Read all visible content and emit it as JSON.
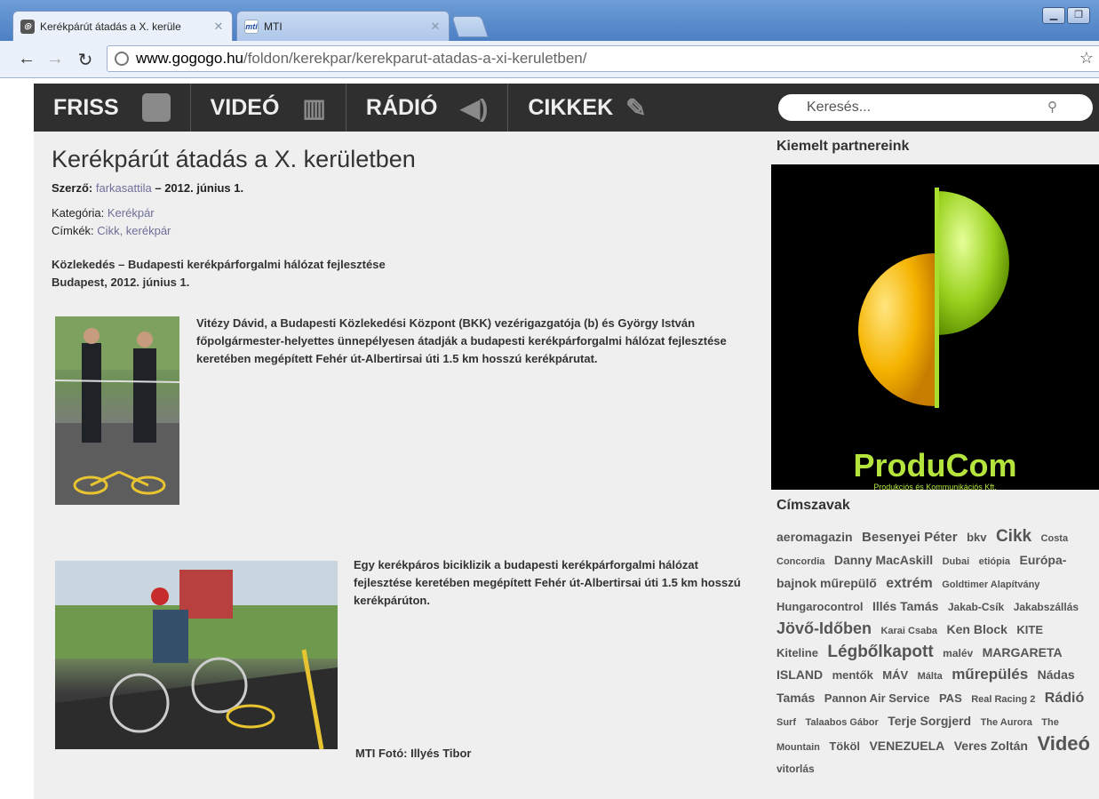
{
  "browser": {
    "tabs": [
      {
        "title": "Kerékpárút átadás a X. kerüle",
        "favicon": "page-icon",
        "active": true
      },
      {
        "title": "MTI",
        "favicon": "mti-icon",
        "favicon_text": "mti",
        "active": false
      }
    ],
    "url_host": "www.gogogo.hu",
    "url_path": "/foldon/kerekpar/kerekparut-atadas-a-xi-keruletben/"
  },
  "nav": {
    "items": [
      {
        "label": "FRISS",
        "icon": "rss-icon"
      },
      {
        "label": "VIDEÓ",
        "icon": "film-icon"
      },
      {
        "label": "RÁDIÓ",
        "icon": "speaker-icon"
      },
      {
        "label": "CIKKEK",
        "icon": "pencil-icon"
      }
    ]
  },
  "search": {
    "placeholder": "Keresés..."
  },
  "article": {
    "title": "Kerékpárút átadás a X. kerületben",
    "author_label": "Szerző:",
    "author": "farkasattila",
    "date": "– 2012. június 1.",
    "category_label": "Kategória:",
    "category": "Kerékpár",
    "tags_label": "Címkék:",
    "tags": "Cikk, kerékpár",
    "lead_line1": "Közlekedés – Budapesti kerékpárforgalmi hálózat fejlesztése",
    "lead_line2": "Budapest, 2012. június 1.",
    "caption1": "Vitézy Dávid, a Budapesti Közlekedési Központ (BKK) vezérigazgatója (b) és György István főpolgármester-helyettes ünnepélyesen átadják a budapesti kerékpárforgalmi hálózat fejlesztése keretében megépített Fehér út-Albertirsai úti 1.5 km hosszú kerékpárutat.",
    "caption2": "Egy kerékpáros biciklizik a budapesti kerékpárforgalmi hálózat fejlesztése keretében megépített Fehér út-Albertirsai úti 1.5 km hosszú kerékpárúton.",
    "photo_credit": "MTI Fotó: Illyés Tibor"
  },
  "sidebar": {
    "partners_heading": "Kiemelt partnereink",
    "banner_brand": "ProduCom",
    "banner_sub": "Produkciós és Kommunikációs Kft.",
    "tagcloud_heading": "Címszavak",
    "tags": [
      {
        "text": "aeromagazin",
        "size": 14
      },
      {
        "text": "Besenyei Péter",
        "size": 15
      },
      {
        "text": "bkv",
        "size": 13
      },
      {
        "text": "Cikk",
        "size": 19
      },
      {
        "text": "Costa Concordia",
        "size": 11
      },
      {
        "text": "Danny MacAskill",
        "size": 14
      },
      {
        "text": "Dubai",
        "size": 11
      },
      {
        "text": "etiópia",
        "size": 11
      },
      {
        "text": "Európa-bajnok műrepülő",
        "size": 14
      },
      {
        "text": "extrém",
        "size": 16
      },
      {
        "text": "Goldtimer Alapítvány",
        "size": 11
      },
      {
        "text": "Hungarocontrol",
        "size": 13
      },
      {
        "text": "Illés Tamás",
        "size": 14
      },
      {
        "text": "Jakab-Csík",
        "size": 12
      },
      {
        "text": "Jakabszállás",
        "size": 12
      },
      {
        "text": "Jövő-Időben",
        "size": 18
      },
      {
        "text": "Karai Csaba",
        "size": 11
      },
      {
        "text": "Ken Block",
        "size": 14
      },
      {
        "text": "KITE",
        "size": 13
      },
      {
        "text": "Kiteline",
        "size": 13
      },
      {
        "text": "Légbőlkapott",
        "size": 19
      },
      {
        "text": "malév",
        "size": 12
      },
      {
        "text": "MARGARETA ISLAND",
        "size": 14
      },
      {
        "text": "mentők",
        "size": 13
      },
      {
        "text": "MÁV",
        "size": 13
      },
      {
        "text": "Málta",
        "size": 11
      },
      {
        "text": "műrepülés",
        "size": 17
      },
      {
        "text": "Nádas Tamás",
        "size": 14
      },
      {
        "text": "Pannon Air Service",
        "size": 13
      },
      {
        "text": "PAS",
        "size": 13
      },
      {
        "text": "Real Racing 2",
        "size": 11
      },
      {
        "text": "Rádió",
        "size": 16
      },
      {
        "text": "Surf",
        "size": 11
      },
      {
        "text": "Talaabos Gábor",
        "size": 11
      },
      {
        "text": "Terje Sorgjerd",
        "size": 14
      },
      {
        "text": "The Aurora",
        "size": 11
      },
      {
        "text": "The Mountain",
        "size": 11
      },
      {
        "text": "Tököl",
        "size": 13
      },
      {
        "text": "VENEZUELA",
        "size": 14
      },
      {
        "text": "Veres Zoltán",
        "size": 14
      },
      {
        "text": "Videó",
        "size": 22
      },
      {
        "text": "vitorlás",
        "size": 12
      }
    ]
  }
}
